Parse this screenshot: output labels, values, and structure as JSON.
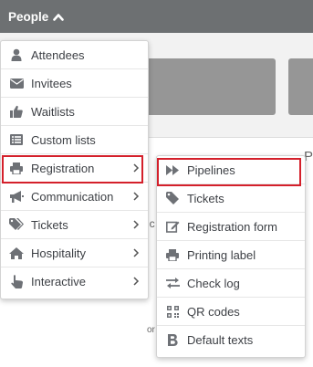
{
  "topbar": {
    "people_label": "People"
  },
  "background": {
    "fragment_1": "P",
    "fragment_2": "ic",
    "fragment_3": "or"
  },
  "main_menu": {
    "items": [
      {
        "label": "Attendees",
        "icon": "person-icon",
        "has_submenu": false
      },
      {
        "label": "Invitees",
        "icon": "envelope-icon",
        "has_submenu": false
      },
      {
        "label": "Waitlists",
        "icon": "thumbs-up-icon",
        "has_submenu": false
      },
      {
        "label": "Custom lists",
        "icon": "list-icon",
        "has_submenu": false
      },
      {
        "label": "Registration",
        "icon": "printer-icon",
        "has_submenu": true,
        "highlighted": true
      },
      {
        "label": "Communication",
        "icon": "megaphone-icon",
        "has_submenu": true
      },
      {
        "label": "Tickets",
        "icon": "tags-icon",
        "has_submenu": true
      },
      {
        "label": "Hospitality",
        "icon": "home-icon",
        "has_submenu": true
      },
      {
        "label": "Interactive",
        "icon": "pointer-hand-icon",
        "has_submenu": true
      }
    ]
  },
  "sub_menu": {
    "items": [
      {
        "label": "Pipelines",
        "icon": "fast-forward-icon",
        "highlighted": true
      },
      {
        "label": "Tickets",
        "icon": "tag-icon"
      },
      {
        "label": "Registration form",
        "icon": "edit-form-icon"
      },
      {
        "label": "Printing label",
        "icon": "printer-icon"
      },
      {
        "label": "Check log",
        "icon": "exchange-arrows-icon"
      },
      {
        "label": "QR codes",
        "icon": "qrcode-icon"
      },
      {
        "label": "Default texts",
        "icon": "bold-b-icon"
      }
    ]
  },
  "colors": {
    "topbar": "#6d7072",
    "highlight": "#d4202b",
    "icon": "#6e7176",
    "text": "#3c3f44"
  }
}
